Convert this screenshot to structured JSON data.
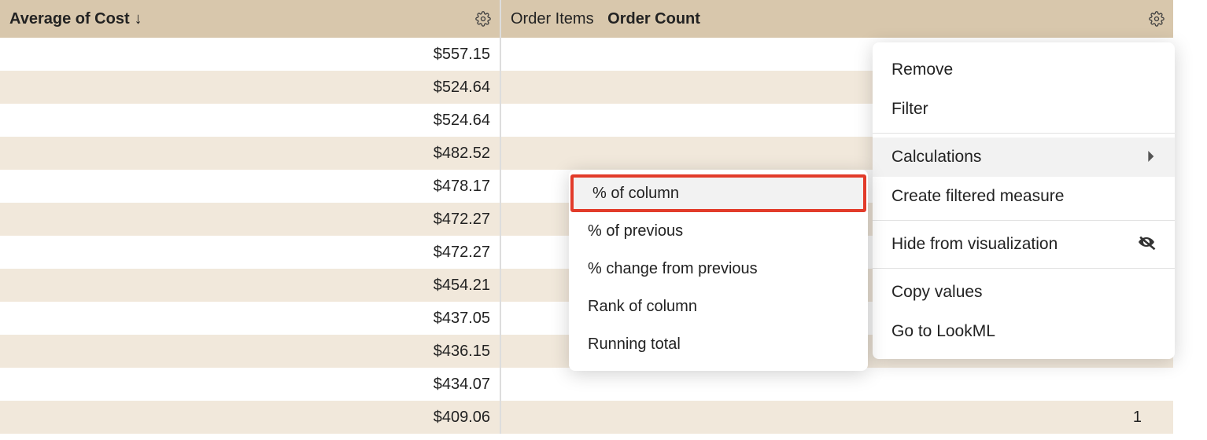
{
  "columns": {
    "col1": {
      "title": "Average of Cost",
      "sort_indicator": "↓"
    },
    "col2": {
      "prefix": "Order Items",
      "title": "Order Count"
    }
  },
  "col1_values": [
    "$557.15",
    "$524.64",
    "$524.64",
    "$482.52",
    "$478.17",
    "$472.27",
    "$472.27",
    "$454.21",
    "$437.05",
    "$436.15",
    "$434.07",
    "$409.06"
  ],
  "col2_partial": "1",
  "menu": {
    "remove": "Remove",
    "filter": "Filter",
    "calculations": "Calculations",
    "create_filtered_measure": "Create filtered measure",
    "hide_from_visualization": "Hide from visualization",
    "copy_values": "Copy values",
    "go_to_lookml": "Go to LookML"
  },
  "submenu": {
    "pct_of_column": "% of column",
    "pct_of_previous": "% of previous",
    "pct_change_from_previous": "% change from previous",
    "rank_of_column": "Rank of column",
    "running_total": "Running total"
  }
}
